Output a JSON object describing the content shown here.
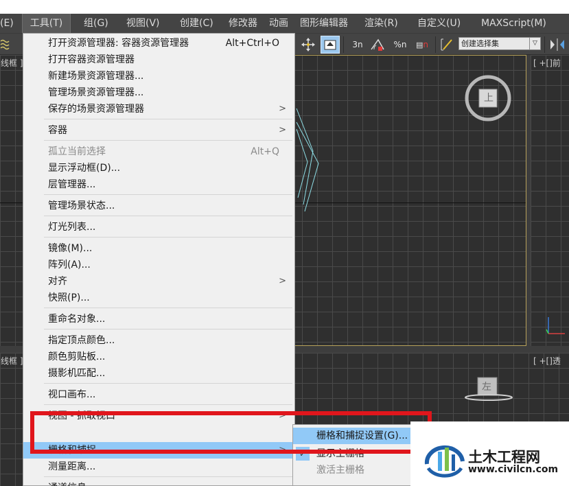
{
  "menubar": {
    "items": [
      {
        "label": "(E)"
      },
      {
        "label": "工具(T)",
        "active": true
      },
      {
        "label": "组(G)"
      },
      {
        "label": "视图(V)"
      },
      {
        "label": "创建(C)"
      },
      {
        "label": "修改器"
      },
      {
        "label": "动画"
      },
      {
        "label": "图形编辑器"
      },
      {
        "label": "渲染(R)"
      },
      {
        "label": "自定义(U)"
      },
      {
        "label": "MAXScript(M)"
      }
    ]
  },
  "toolbar": {
    "snap_labels": [
      "3n",
      "%n",
      "n"
    ],
    "named_selection_set": "创建选择集"
  },
  "viewports": {
    "top_left_label": "线框 ]",
    "top_right_label": "[ +[]前",
    "bottom_left_label": "线框 ]",
    "bottom_right_label": "[ +[]透",
    "cube_top": "上",
    "cube_bottom": "左"
  },
  "tools_menu": {
    "items": [
      {
        "label": "打开资源管理器: 容器资源管理器",
        "shortcut": "Alt+Ctrl+O"
      },
      {
        "label": "打开容器资源管理器"
      },
      {
        "label": "新建场景资源管理器..."
      },
      {
        "label": "管理场景资源管理器..."
      },
      {
        "label": "保存的场景资源管理器",
        "submenu": true
      },
      {
        "label": "容器",
        "submenu": true
      },
      {
        "label": "孤立当前选择",
        "shortcut": "Alt+Q",
        "disabled": true
      },
      {
        "label": "显示浮动框(D)..."
      },
      {
        "label": "层管理器..."
      },
      {
        "label": "管理场景状态..."
      },
      {
        "label": "灯光列表..."
      },
      {
        "label": "镜像(M)..."
      },
      {
        "label": "阵列(A)..."
      },
      {
        "label": "对齐",
        "submenu": true
      },
      {
        "label": "快照(P)..."
      },
      {
        "label": "重命名对象..."
      },
      {
        "label": "指定顶点颜色..."
      },
      {
        "label": "颜色剪贴板..."
      },
      {
        "label": "摄影机匹配..."
      },
      {
        "label": "视口画布..."
      },
      {
        "label": "视图 - 抓取视口",
        "submenu": true
      },
      {
        "label": "栅格和捕捉",
        "submenu": true,
        "highlighted": true
      },
      {
        "label": "测量距离..."
      },
      {
        "label": "通道信息..."
      }
    ]
  },
  "grid_snap_submenu": {
    "items": [
      {
        "label": "栅格和捕捉设置(G)...",
        "highlighted": true
      },
      {
        "label": "显示主栅格",
        "checked": true
      },
      {
        "label": "激活主栅格",
        "disabled": true
      }
    ]
  },
  "watermark": {
    "title": "土木工程网",
    "url": "www.civilcn.com"
  },
  "colors": {
    "highlight": "#91c9f7",
    "annotation": "#e0161c",
    "viewport_bg": "#2f2f2f"
  }
}
